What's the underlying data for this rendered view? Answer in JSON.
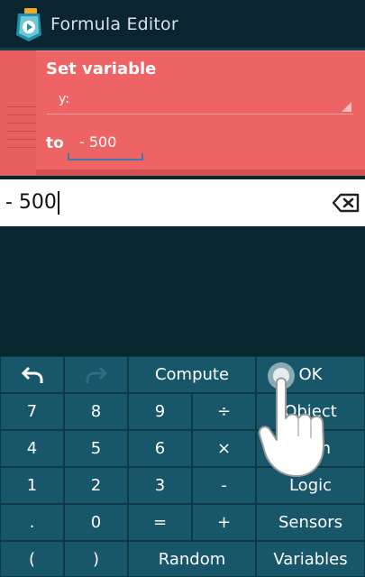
{
  "titlebar": {
    "title": "Formula Editor"
  },
  "brick": {
    "title": "Set variable",
    "variable": "y:",
    "to_label": "to",
    "value": "- 500"
  },
  "editor": {
    "formula": "- 500"
  },
  "keyboard": {
    "undo": "undo-icon",
    "redo": "redo-icon",
    "compute": "Compute",
    "ok": "OK",
    "rows": [
      [
        "7",
        "8",
        "9",
        "÷",
        "Object"
      ],
      [
        "4",
        "5",
        "6",
        "×",
        "Math"
      ],
      [
        "1",
        "2",
        "3",
        "-",
        "Logic"
      ],
      [
        ".",
        "0",
        "=",
        "+",
        "Sensors"
      ],
      [
        "(",
        ")",
        "Random",
        "Variables"
      ]
    ]
  },
  "colors": {
    "brick": "#ee6464",
    "keyboard": "#18566a",
    "background": "#07262f"
  }
}
